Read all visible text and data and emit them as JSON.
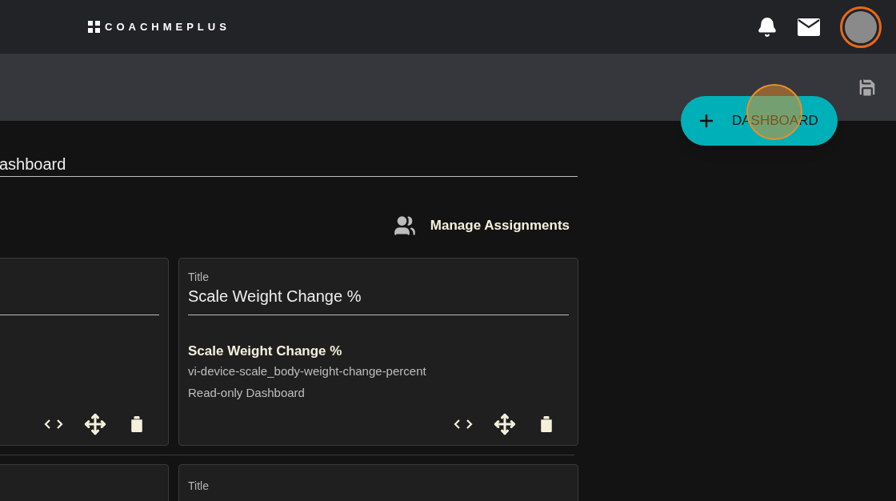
{
  "header": {
    "logo": "COACHMEPLUS"
  },
  "fab": {
    "label": "DASHBOARD"
  },
  "dashboard_name": {
    "value": "ashboard"
  },
  "manage_assignments": {
    "label": "Manage Assignments"
  },
  "widgets": [
    {
      "actions": [
        {
          "kind": "code"
        },
        {
          "kind": "move"
        },
        {
          "kind": "delete"
        }
      ]
    },
    {
      "actions": [
        {
          "kind": "code"
        },
        {
          "kind": "move"
        },
        {
          "kind": "delete"
        }
      ],
      "title_label": "Title",
      "title": "Scale Weight Change %",
      "metric_name": "Scale Weight Change %",
      "metric_id": "vi-device-scale_body-weight-change-percent",
      "dashboard": "Read-only Dashboard"
    }
  ],
  "next_row": {
    "title_label": "Title"
  }
}
